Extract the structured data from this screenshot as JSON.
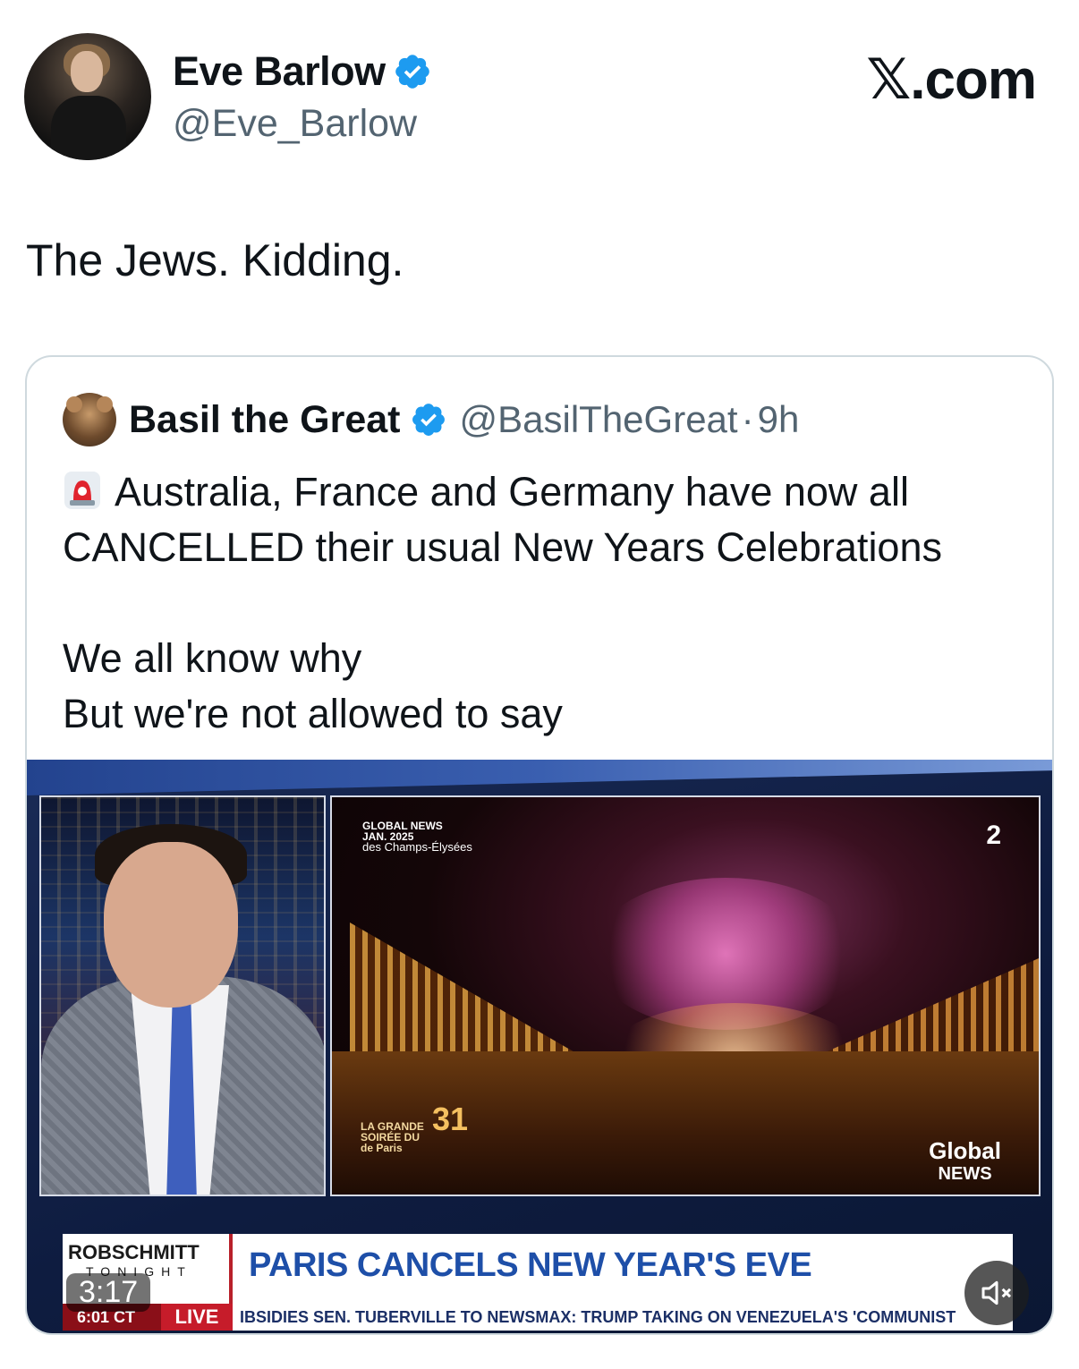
{
  "author": {
    "name": "Eve Barlow",
    "handle": "@Eve_Barlow",
    "verified_icon": "verified-badge-icon"
  },
  "brand": "𝕏.com",
  "tweet": {
    "text": "The Jews. Kidding."
  },
  "quoted_tweet": {
    "name": "Basil the Great",
    "handle": "@BasilTheGreat",
    "separator": "·",
    "time": "9h",
    "lines": [
      "Australia, France and Germany have now all",
      "CANCELLED their usual New Years Celebrations",
      "",
      "We all know why",
      "But we're not allowed to say"
    ],
    "emoji_icon": "police-siren-icon"
  },
  "video": {
    "duration": "3:17",
    "overlay": {
      "global_news_mark": "GLOBAL NEWS",
      "date_mark": "JAN. 2025",
      "location_mark": "des Champs-Élysées",
      "channel": "2",
      "soiree_l1": "LA GRANDE",
      "soiree_l2": "SOIRÉE DU",
      "soiree_l3": "de Paris",
      "soiree_num": "31",
      "global_l1": "Global",
      "global_l2": "NEWS",
      "show_l1": "ROBSCHMITT",
      "show_l2": "TONIGHT",
      "headline": "PARIS CANCELS NEW YEAR'S EVE",
      "ticker_time": "6:01 CT",
      "ticker_live": "LIVE",
      "ticker_text": "IBSIDIES       SEN. TUBERVILLE TO NEWSMAX: TRUMP TAKING ON VENEZUELA'S 'COMMUNIST"
    },
    "mute_icon": "speaker-muted-icon"
  },
  "colors": {
    "verified": "#1d9bf0",
    "handle": "#536471",
    "border": "#cfd9de"
  }
}
